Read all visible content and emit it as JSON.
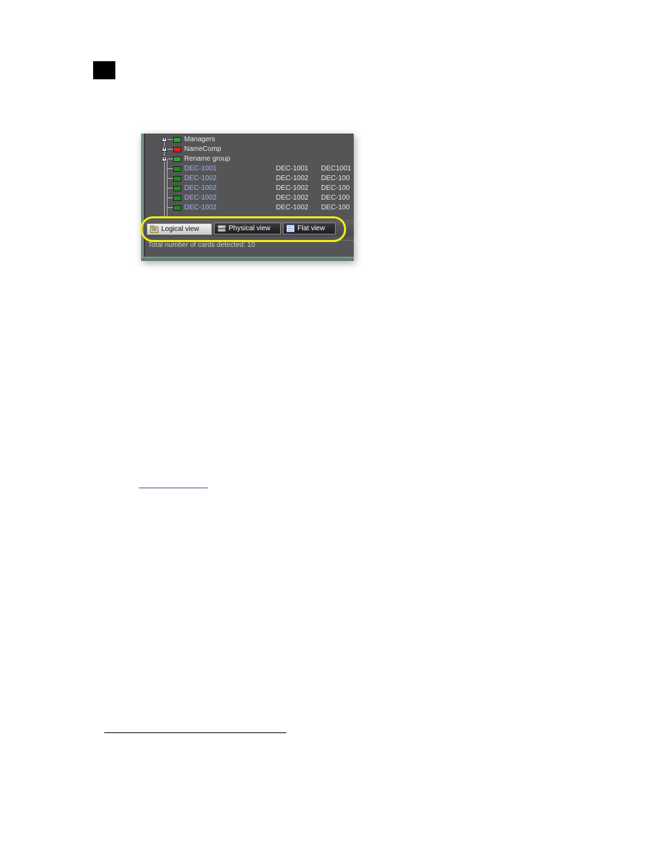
{
  "tree": {
    "rows": [
      {
        "label": "Managers",
        "status_color": "#2fa32f",
        "expander": "+",
        "col1": "",
        "col2": ""
      },
      {
        "label": "NameComp",
        "status_color": "#e02020",
        "expander": "+",
        "col1": "",
        "col2": ""
      },
      {
        "label": "Rename group",
        "status_color": "#2fa32f",
        "expander": "+",
        "col1": "",
        "col2": ""
      },
      {
        "label": "DEC-1001",
        "status_color": "#1f8a1f",
        "expander": "",
        "col1": "DEC-1001",
        "col2": "DEC1001"
      },
      {
        "label": "DEC-1002",
        "status_color": "#1f8a1f",
        "expander": "",
        "col1": "DEC-1002",
        "col2": "DEC-100"
      },
      {
        "label": "DEC-1002",
        "status_color": "#1f8a1f",
        "expander": "",
        "col1": "DEC-1002",
        "col2": "DEC-100"
      },
      {
        "label": "DEC-1002",
        "status_color": "#1f8a1f",
        "expander": "",
        "col1": "DEC-1002",
        "col2": "DEC-100"
      },
      {
        "label": "DEC-1002",
        "status_color": "#1f8a1f",
        "expander": "",
        "col1": "DEC-1002",
        "col2": "DEC-100"
      }
    ]
  },
  "tabs": [
    {
      "label": "Logical view",
      "icon": "folder-icon",
      "active": true
    },
    {
      "label": "Physical view",
      "icon": "drive-icon",
      "active": false
    },
    {
      "label": "Flat view",
      "icon": "list-icon",
      "active": false
    }
  ],
  "status_bar": {
    "text": "Total number of cards detected: 10"
  },
  "colors": {
    "highlight": "#f2ea1a",
    "link": "#9fb3f2"
  }
}
